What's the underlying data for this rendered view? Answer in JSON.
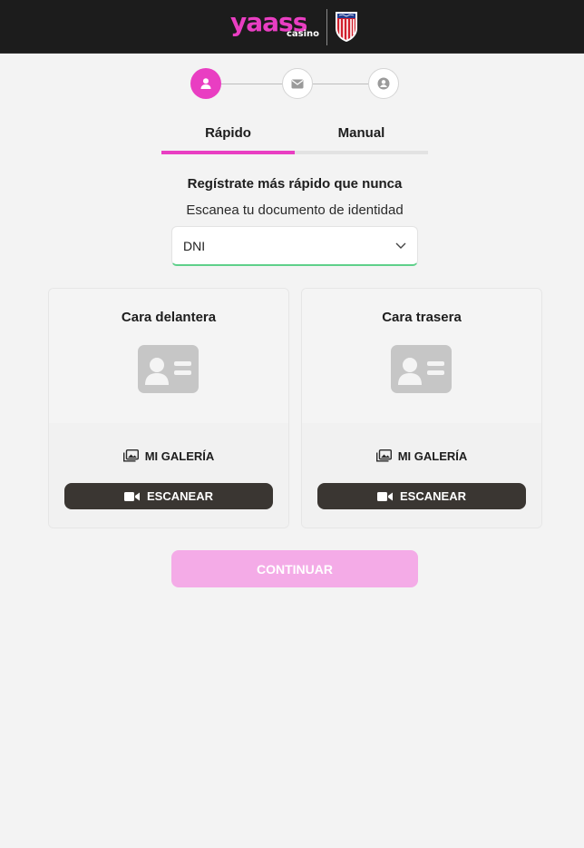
{
  "header": {
    "brand_main": "yaass",
    "brand_sub": "casino",
    "brand_color": "#e93ec2"
  },
  "stepper": {
    "steps": [
      {
        "icon": "user-icon",
        "state": "active"
      },
      {
        "icon": "envelope-icon",
        "state": "idle"
      },
      {
        "icon": "user-circle-icon",
        "state": "idle"
      }
    ]
  },
  "tabs": [
    {
      "label": "Rápido",
      "active": true
    },
    {
      "label": "Manual",
      "active": false
    }
  ],
  "intro": {
    "headline": "Regístrate más rápido que nunca",
    "subline": "Escanea tu documento de identidad"
  },
  "document_select": {
    "value": "DNI",
    "icon": "chevron-down-icon"
  },
  "cards": [
    {
      "title": "Cara delantera",
      "icon": "id-card-icon",
      "gallery_label": "MI GALERÍA",
      "scan_label": "ESCANEAR"
    },
    {
      "title": "Cara trasera",
      "icon": "id-card-icon",
      "gallery_label": "MI GALERÍA",
      "scan_label": "ESCANEAR"
    }
  ],
  "continue_label": "CONTINUAR",
  "colors": {
    "accent": "#e93ec2",
    "accent_disabled": "#f4abe7",
    "dark_button": "#3a3632",
    "select_focus": "#5ed08a"
  }
}
